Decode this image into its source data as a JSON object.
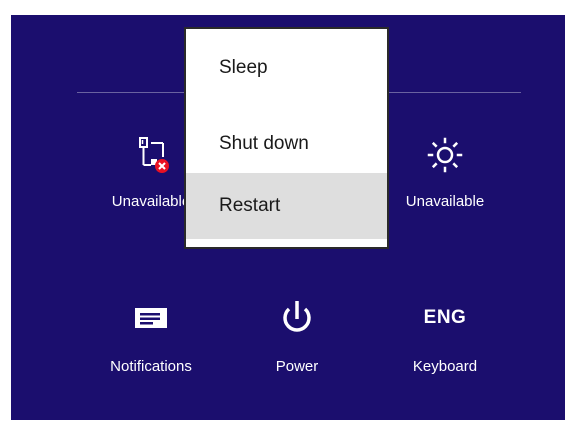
{
  "tiles": {
    "network": {
      "label": "Unavailable",
      "icon": "network-unavailable-icon"
    },
    "brightness": {
      "label": "Unavailable",
      "icon": "brightness-icon"
    },
    "notifications": {
      "label": "Notifications",
      "icon": "notifications-icon"
    },
    "power": {
      "label": "Power",
      "icon": "power-icon"
    },
    "keyboard": {
      "label": "Keyboard",
      "icon_text": "ENG"
    }
  },
  "power_menu": {
    "items": [
      {
        "label": "Sleep",
        "selected": false
      },
      {
        "label": "Shut down",
        "selected": false
      },
      {
        "label": "Restart",
        "selected": true
      }
    ]
  },
  "colors": {
    "panel_background": "#1b0e6e",
    "menu_background": "#ffffff",
    "menu_selected": "#dedede",
    "error_badge": "#e81123"
  }
}
